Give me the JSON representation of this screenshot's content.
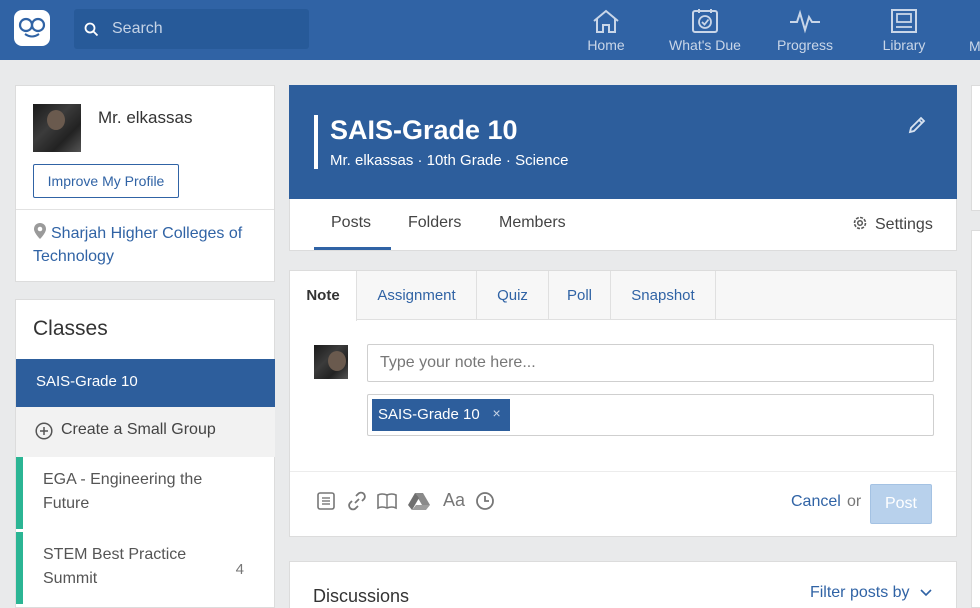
{
  "nav": {
    "search_placeholder": "Search",
    "items": [
      {
        "label": "Home",
        "icon": "home-icon"
      },
      {
        "label": "What's Due",
        "icon": "calendar-check-icon"
      },
      {
        "label": "Progress",
        "icon": "pulse-icon"
      },
      {
        "label": "Library",
        "icon": "library-icon"
      },
      {
        "label": "M",
        "icon": "more-icon"
      }
    ]
  },
  "profile": {
    "name": "Mr. elkassas",
    "improve_button": "Improve My Profile",
    "school": "Sharjah Higher Colleges of Technology"
  },
  "classes": {
    "title": "Classes",
    "active_class": "SAIS-Grade 10",
    "create_small_group": "Create a Small Group",
    "items": [
      {
        "name": "EGA - Engineering the Future",
        "count": ""
      },
      {
        "name": "STEM Best Practice Summit",
        "count": "4"
      }
    ]
  },
  "group": {
    "title": "SAIS-Grade 10",
    "subtitle": "Mr. elkassas · 10th Grade · Science",
    "tabs": [
      "Posts",
      "Folders",
      "Members"
    ],
    "settings_label": "Settings"
  },
  "composer": {
    "tabs": [
      "Note",
      "Assignment",
      "Quiz",
      "Poll",
      "Snapshot"
    ],
    "note_placeholder": "Type your note here...",
    "recipient_chip": "SAIS-Grade 10",
    "chip_remove": "×",
    "cancel_label": "Cancel",
    "or_label": "or",
    "post_label": "Post",
    "toolbar_icons": [
      "file-icon",
      "link-icon",
      "library-book-icon",
      "google-drive-icon",
      "text-format-icon",
      "clock-icon"
    ],
    "toolbar_text_icon": "Aa"
  },
  "discussions": {
    "title": "Discussions",
    "filter_label": "Filter posts by"
  },
  "colors": {
    "primary": "#3063a5",
    "header_blue": "#2d5e9c",
    "accent_green": "#2bb594",
    "post_disabled": "#b8d1ec"
  }
}
